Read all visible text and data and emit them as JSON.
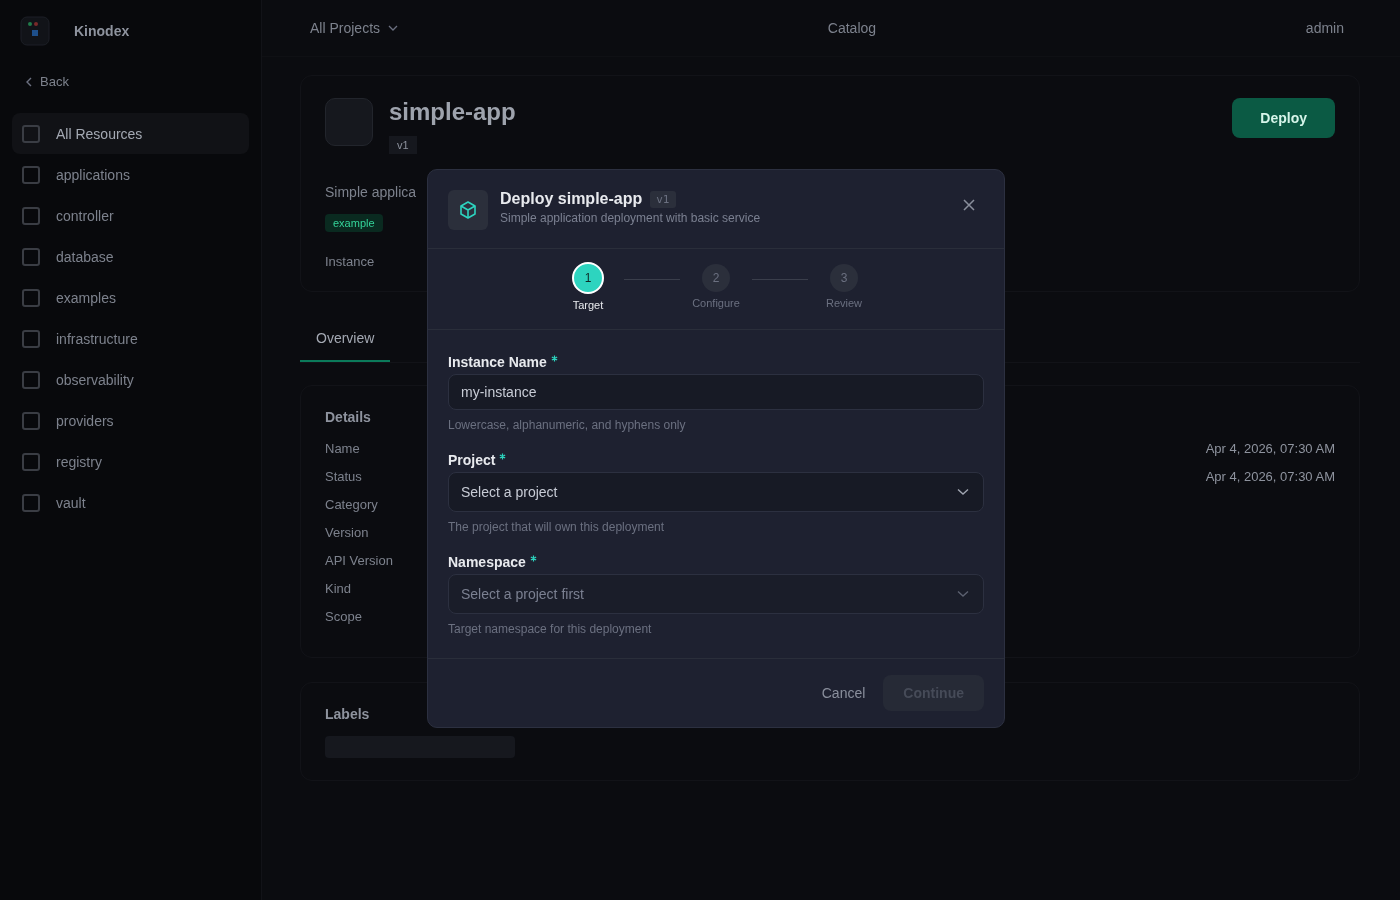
{
  "backdrop": {
    "brand": "Kinodex",
    "back": "Back",
    "sidebar": [
      {
        "label": "All Resources",
        "selected": true
      },
      {
        "label": "applications",
        "selected": false
      },
      {
        "label": "controller",
        "selected": false
      },
      {
        "label": "database",
        "selected": false
      },
      {
        "label": "examples",
        "selected": false
      },
      {
        "label": "infrastructure",
        "selected": false
      },
      {
        "label": "observability",
        "selected": false
      },
      {
        "label": "providers",
        "selected": false
      },
      {
        "label": "registry",
        "selected": false
      },
      {
        "label": "vault",
        "selected": false
      }
    ],
    "project_switcher": "All Projects",
    "page_title": "Catalog",
    "user": "admin",
    "package": {
      "name": "simple-app",
      "version": "v1",
      "description": "Simple applica",
      "tag": "example",
      "meta": "Instance",
      "deploy": "Deploy"
    },
    "tabs": [
      {
        "label": "Overview",
        "selected": true
      }
    ],
    "details": {
      "title": "Details",
      "labels": [
        "Name",
        "Status",
        "Category",
        "Version",
        "API Version",
        "Kind",
        "Scope"
      ],
      "values": [
        "Apr 4, 2026, 07:30 AM",
        "Apr 4, 2026, 07:30 AM"
      ]
    },
    "labels_card": {
      "title": "Labels"
    }
  },
  "dialog": {
    "title": "Deploy simple-app",
    "version": "v1",
    "subtitle": "Simple application deployment with basic service",
    "steps": [
      {
        "number": "1",
        "label": "Target",
        "selected": true
      },
      {
        "number": "2",
        "label": "Configure",
        "selected": false
      },
      {
        "number": "3",
        "label": "Review",
        "selected": false
      }
    ],
    "fields": [
      {
        "kind": "input",
        "label": "Instance Name",
        "required": true,
        "value": "my-instance",
        "hint": "Lowercase, alphanumeric, and hyphens only",
        "disabled": false
      },
      {
        "kind": "select",
        "label": "Project",
        "required": true,
        "placeholder": "Select a project",
        "hint": "The project that will own this deployment",
        "disabled": false
      },
      {
        "kind": "select",
        "label": "Namespace",
        "required": true,
        "placeholder": "Select a project first",
        "hint": "Target namespace for this deployment",
        "disabled": true
      }
    ],
    "cancel": "Cancel",
    "continue": {
      "label": "Continue",
      "disabled": true
    }
  }
}
